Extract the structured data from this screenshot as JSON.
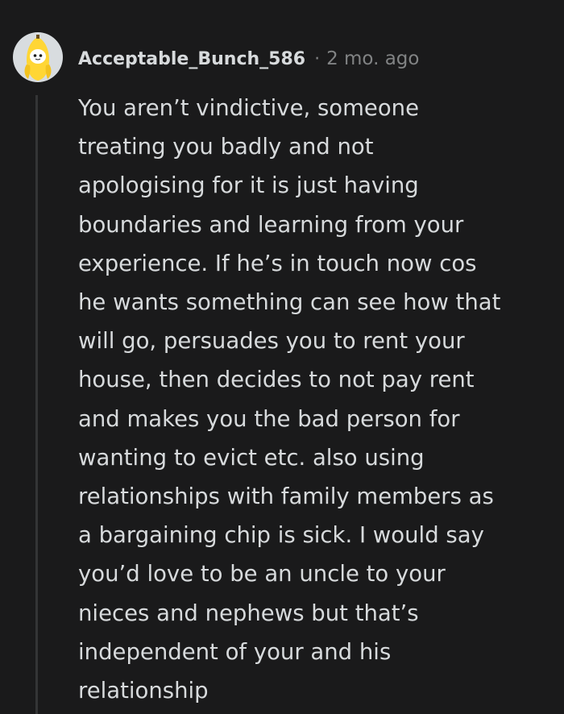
{
  "comment": {
    "username": "Acceptable_Bunch_586",
    "separator": "·",
    "timestamp": "2 mo. ago",
    "avatar_icon": "banana-snoo-avatar-icon",
    "body": "You aren’t vindictive, someone\ntreating you badly and not\napologising for it is just having\nboundaries and learning from your\nexperience. If he’s in touch now cos\nhe wants something can see how that\nwill go, persuades you to rent your\nhouse, then decides to not pay rent\nand makes you the bad person for\nwanting to evict etc. also using\nrelationships with family members as\na bargaining chip is sick. I would say\nyou’d love to be an uncle to your\nnieces and nephews but that’s\nindependent of your and his\nrelationship"
  },
  "colors": {
    "background": "#1a1a1b",
    "text": "#d7dadc",
    "meta": "#818384",
    "thread_line": "#343536",
    "avatar_bg": "#d8dcdf",
    "banana": "#ffd635"
  }
}
